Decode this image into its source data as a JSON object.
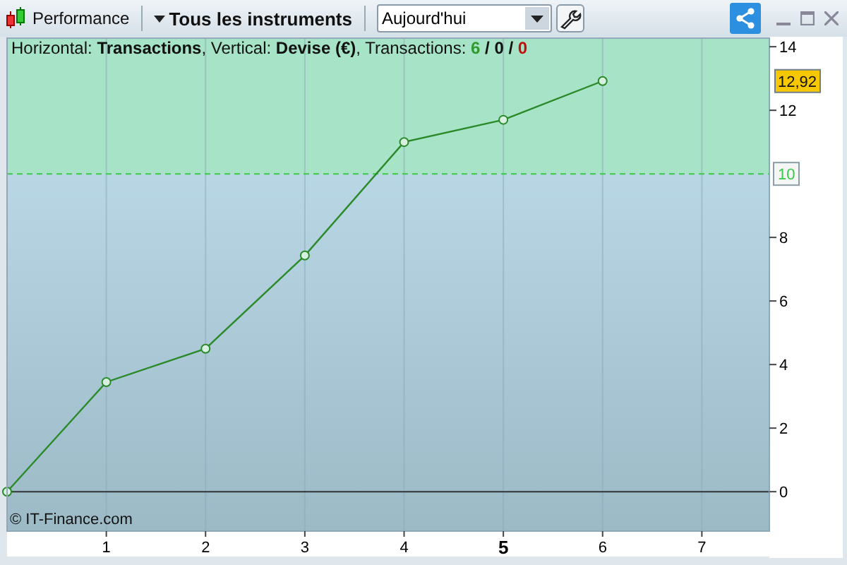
{
  "toolbar": {
    "performance_label": "Performance",
    "instruments_menu": "Tous les instruments",
    "period_select": {
      "value": "Aujourd'hui"
    }
  },
  "info": {
    "text": "Horizontal: **Transactions**, Vertical: **Devise (€)**, Transactions: ",
    "separator": "/",
    "counts": [
      {
        "value": "6",
        "color": "#2e9a2e"
      },
      {
        "value": "0",
        "color": "#111111"
      },
      {
        "value": "0",
        "color": "#c01010"
      }
    ]
  },
  "chart": {
    "chart_data": {
      "type": "line",
      "x": [
        0,
        1,
        2,
        3,
        4,
        5,
        6
      ],
      "series": [
        {
          "color": "#2a8a2a",
          "marker": "circle",
          "values": [
            0,
            3.45,
            4.5,
            7.43,
            11,
            11.7,
            12.92
          ]
        }
      ],
      "grid": true,
      "xlim": [
        0,
        7.68
      ],
      "ylim": [
        -1.24,
        14.27
      ],
      "xticks": [
        1,
        2,
        3,
        4,
        5,
        6,
        7
      ],
      "yticks": [
        0,
        2,
        4,
        6,
        8,
        12,
        14
      ],
      "ref_lines": [
        {
          "axis": "y",
          "value": 10,
          "label": "10",
          "color": "#3cc94a"
        }
      ],
      "bands": [
        {
          "axis": "y",
          "from": 10,
          "to": 14.27,
          "color": "#a7e3c6"
        }
      ]
    },
    "bold_xtick": "5",
    "last_value": "12,92",
    "copyright": "© IT-Finance.com"
  }
}
